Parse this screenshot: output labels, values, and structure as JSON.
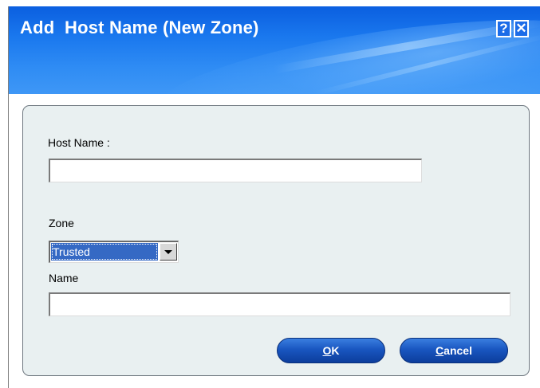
{
  "window": {
    "title": "Add  Host Name (New Zone)",
    "help_label": "?",
    "close_label": "✕"
  },
  "form": {
    "host_name_label": "Host Name :",
    "host_name_value": "",
    "zone_label": "Zone",
    "zone_selected": "Trusted",
    "name_label": "Name",
    "name_value": ""
  },
  "buttons": {
    "ok_label": "OK",
    "cancel_label": "Cancel"
  },
  "colors": {
    "titlebar": "#1a78ee",
    "panel_bg": "#e9f0f1",
    "button_blue": "#1956c0",
    "selection": "#3569c4"
  }
}
